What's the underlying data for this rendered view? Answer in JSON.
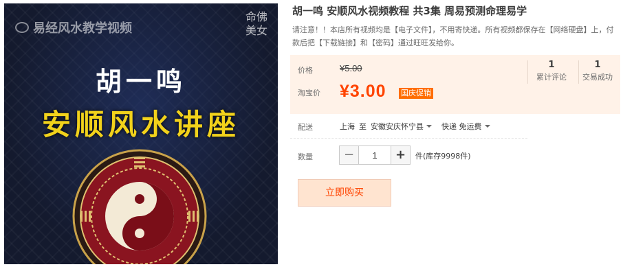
{
  "image": {
    "watermark": "易经风水教学视频",
    "seal_text": "命佛美女",
    "title": "胡一鸣",
    "subtitle": "安顺风水讲座",
    "bagua_chars": [
      "乾",
      "兑",
      "离",
      "震",
      "巽",
      "坎",
      "艮",
      "坤"
    ]
  },
  "product": {
    "title": "胡一鸣 安顺风水视频教程 共3集 周易预测命理易学",
    "notice": "请注意！！本店所有视频均是【电子文件】，不用寄快递。所有视频都保存在【网络硬盘】上，付款后把【下载链接】和【密码】通过旺旺发给你。"
  },
  "price": {
    "label": "价格",
    "original": "¥5.00",
    "tb_label": "淘宝价",
    "current": "¥3.00",
    "promo": "国庆促销"
  },
  "stats": [
    {
      "count": "1",
      "label": "累计评论"
    },
    {
      "count": "1",
      "label": "交易成功"
    }
  ],
  "shipping": {
    "label": "配送",
    "from": "上海",
    "to_word": "至",
    "to": "安徽安庆怀宁县",
    "method": "快递 免运费"
  },
  "quantity": {
    "label": "数量",
    "value": "1",
    "minus": "−",
    "plus": "+",
    "stock": "件(库存9998件)"
  },
  "buy_button": "立即购买",
  "colors": {
    "price_red": "#ff4400",
    "promo_orange": "#ff6d00",
    "panel_bg": "#fff2e8",
    "buy_bg": "#ffe4d0"
  }
}
